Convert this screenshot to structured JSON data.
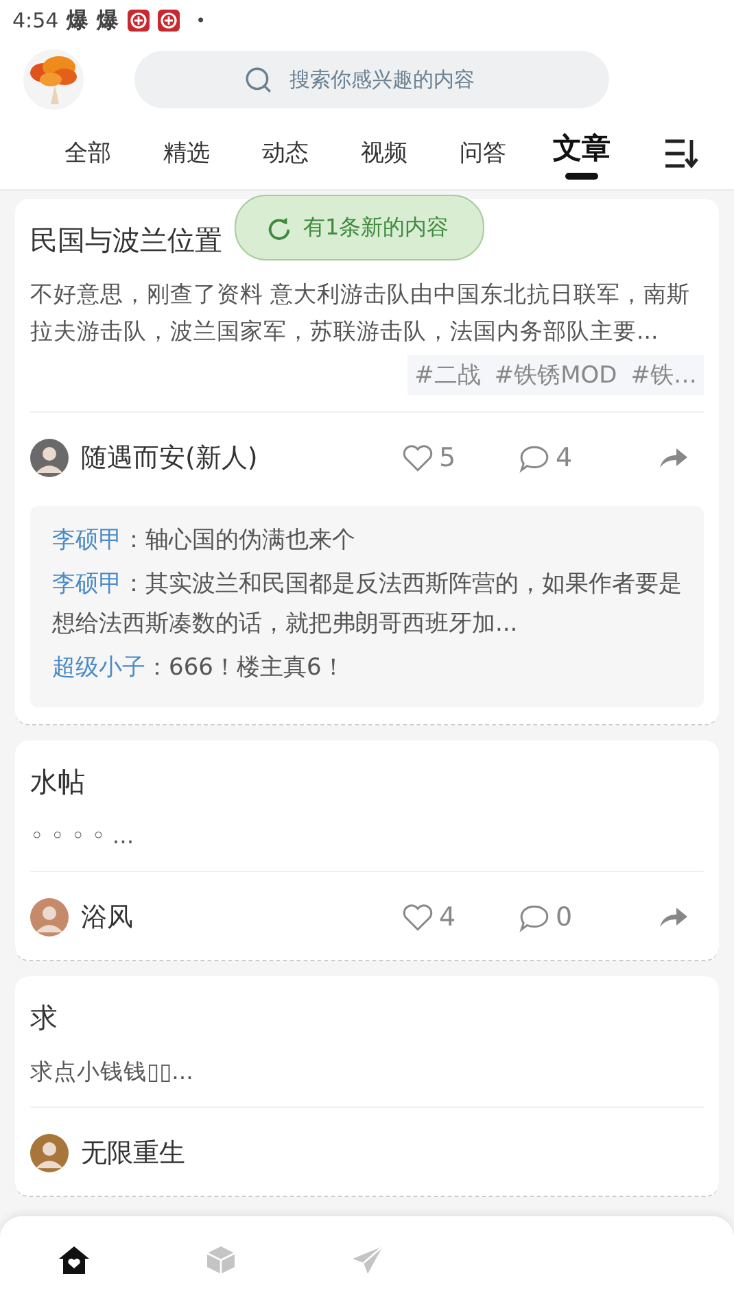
{
  "status_bar": {
    "time": "4:54",
    "chars": [
      "爆",
      "爆"
    ],
    "dot": "•"
  },
  "search": {
    "placeholder": "搜索你感兴趣的内容"
  },
  "tabs": [
    {
      "label": "全部",
      "selected": false
    },
    {
      "label": "精选",
      "selected": false
    },
    {
      "label": "动态",
      "selected": false
    },
    {
      "label": "视频",
      "selected": false
    },
    {
      "label": "问答",
      "selected": false
    },
    {
      "label": "文章",
      "selected": true
    }
  ],
  "toast": "有1条新的内容",
  "posts": [
    {
      "title": "民国与波兰位置",
      "excerpt": "不好意思，刚查了资料 意大利游击队由中国东北抗日联军，南斯拉夫游击队，波兰国家军，苏联游击队，法国内务部队主要...",
      "tags": [
        "#二战",
        "#铁锈MOD",
        "#铁…"
      ],
      "author": "随遇而安(新人)",
      "likes": "5",
      "comments_count": "4",
      "comments": [
        {
          "author": "李硕甲",
          "text": "：轴心国的伪满也来个"
        },
        {
          "author": "李硕甲",
          "text": "：其实波兰和民国都是反法西斯阵营的，如果作者要是想给法西斯凑数的话，就把弗朗哥西班牙加..."
        },
        {
          "author": "超级小子",
          "text": "：666！楼主真6！"
        }
      ]
    },
    {
      "title": "水帖",
      "excerpt": "◦ ◦ ◦ ◦ ...",
      "author": "浴风",
      "likes": "4",
      "comments_count": "0"
    },
    {
      "title": "求",
      "excerpt": "求点小钱钱▯▯...",
      "author": "无限重生"
    }
  ],
  "nav": [
    {
      "kind": "home",
      "selected": true
    },
    {
      "kind": "box",
      "selected": false
    },
    {
      "kind": "send",
      "selected": false
    }
  ]
}
